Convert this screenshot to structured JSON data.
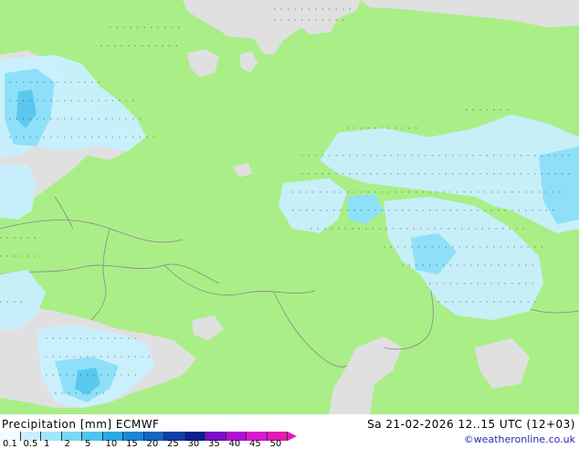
{
  "map": {
    "colors": {
      "land": "#aaee88",
      "sea": "#e0e0e0",
      "border": "#888888",
      "precip_light": "#c8f0ff",
      "precip_mid": "#8ee0f8",
      "precip_heavy": "#5ac8ee"
    }
  },
  "footer": {
    "title": "Precipitation [mm]  ECMWF",
    "valid_time": "Sa 21-02-2026 12..15 UTC (12+03)",
    "credit": "©weatheronline.co.uk",
    "scale_labels": [
      "0.1",
      "0.5",
      "1",
      "2",
      "5",
      "10",
      "15",
      "20",
      "25",
      "30",
      "35",
      "40",
      "45",
      "50"
    ],
    "scale_colors": [
      "#f0fcff",
      "#c8f0ff",
      "#a0e6fb",
      "#78d8f5",
      "#4ec4ee",
      "#2aa8e4",
      "#1a86d6",
      "#1464c4",
      "#0e40ac",
      "#0a1e92",
      "#7a10c8",
      "#b012d4",
      "#d818d0",
      "#e41ab4"
    ]
  }
}
